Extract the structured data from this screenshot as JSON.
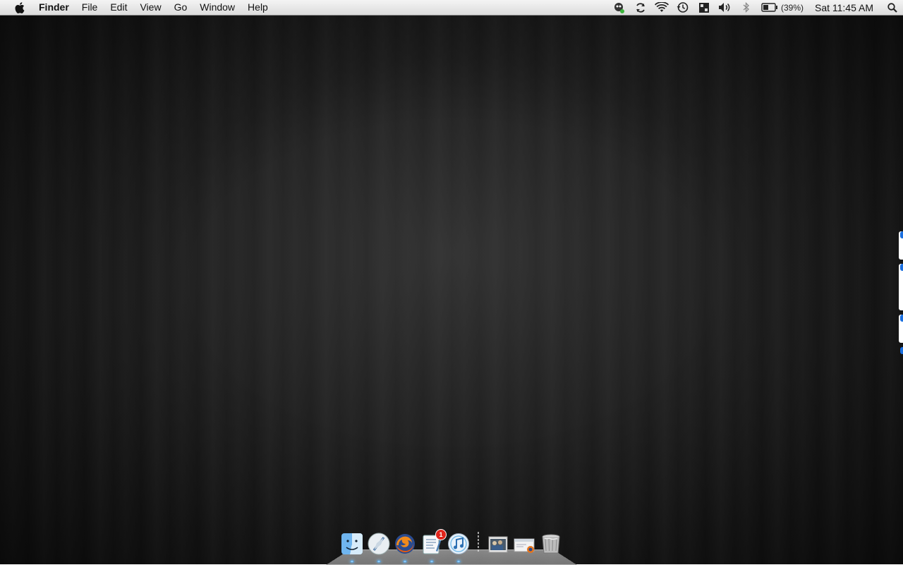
{
  "menubar": {
    "app_name": "Finder",
    "menus": [
      "File",
      "Edit",
      "View",
      "Go",
      "Window",
      "Help"
    ],
    "status": {
      "battery_percent": "(39%)",
      "clock": "Sat 11:45 AM"
    }
  },
  "dock": {
    "items": [
      {
        "name": "finder-icon",
        "running": true
      },
      {
        "name": "browser-icon",
        "running": true
      },
      {
        "name": "firefox-icon",
        "running": true
      },
      {
        "name": "textedit-icon",
        "running": true,
        "badge": "1"
      },
      {
        "name": "itunes-icon",
        "running": true
      }
    ],
    "stacks": [
      {
        "name": "pictures-stack-icon"
      },
      {
        "name": "downloads-stack-icon"
      },
      {
        "name": "trash-icon"
      }
    ],
    "badge_text": "1"
  },
  "colors": {
    "menubar_top": "#f4f4f4",
    "menubar_bottom": "#dcdcdc",
    "desktop": "#1c1c1c",
    "indicator": "#4a9de0",
    "badge": "#e0241b",
    "edge_accent": "#1a6fe0"
  }
}
